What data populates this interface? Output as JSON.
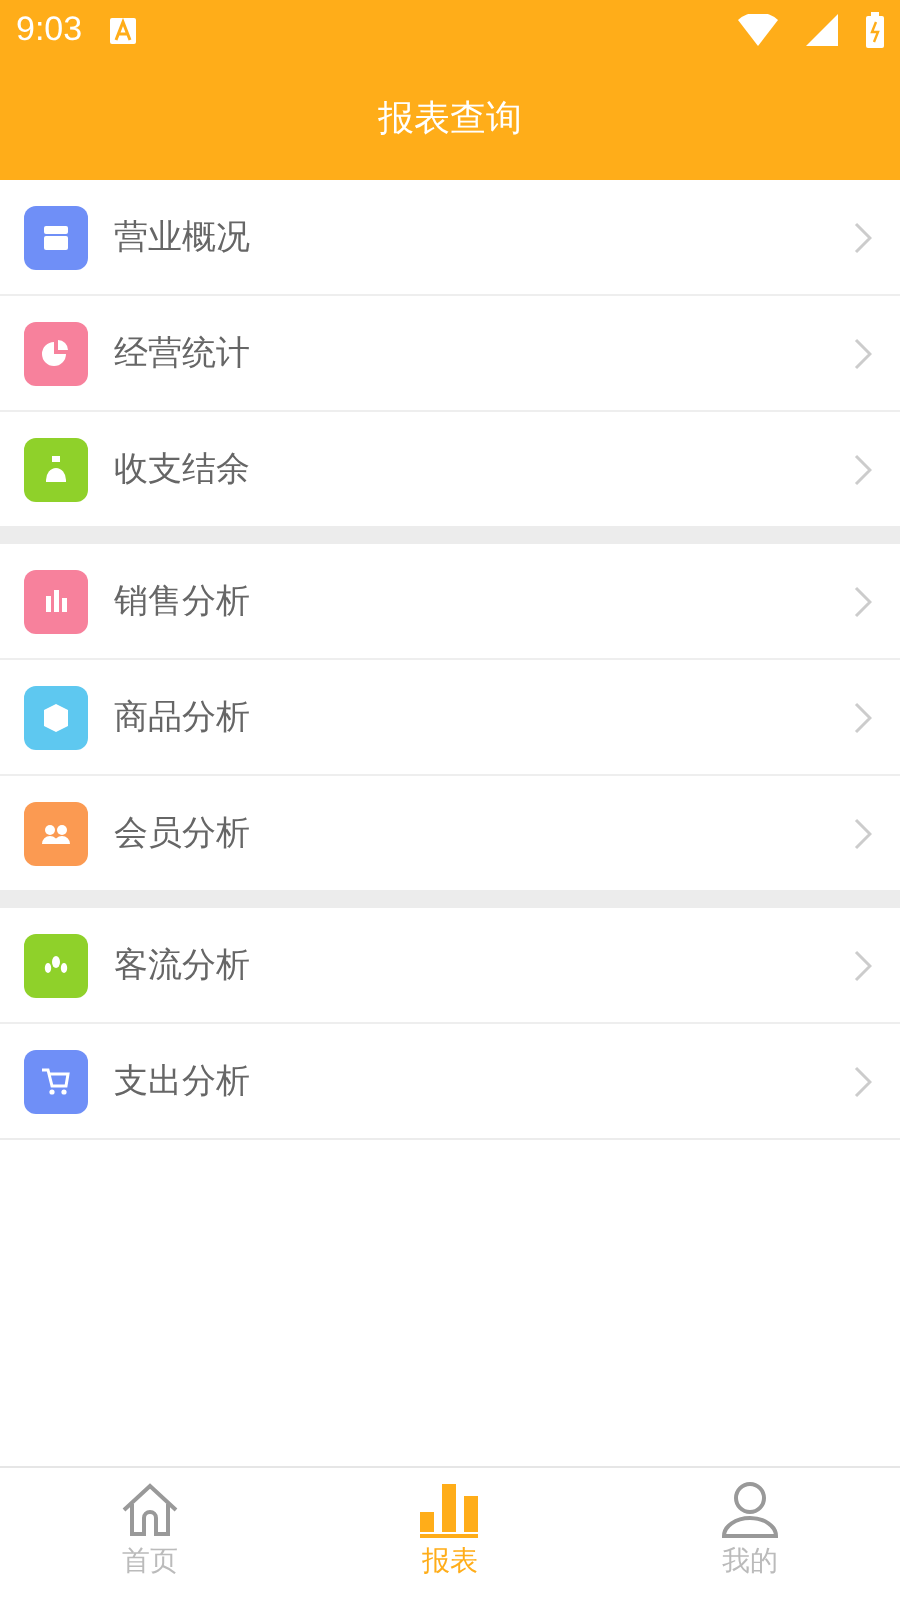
{
  "status_bar": {
    "time": "9:03"
  },
  "header": {
    "title": "报表查询"
  },
  "groups": [
    {
      "items": [
        {
          "label": "营业概况",
          "color": "#6f8ff7"
        },
        {
          "label": "经营统计",
          "color": "#f7819c"
        },
        {
          "label": "收支结余",
          "color": "#8fd12a"
        }
      ]
    },
    {
      "items": [
        {
          "label": "销售分析",
          "color": "#f7819c"
        },
        {
          "label": "商品分析",
          "color": "#5ec8f0"
        },
        {
          "label": "会员分析",
          "color": "#fb9a52"
        }
      ]
    },
    {
      "items": [
        {
          "label": "客流分析",
          "color": "#8fd12a"
        },
        {
          "label": "支出分析",
          "color": "#6f8ff7"
        }
      ]
    }
  ],
  "tabs": [
    {
      "label": "首页",
      "selected": false
    },
    {
      "label": "报表",
      "selected": true
    },
    {
      "label": "我的",
      "selected": false
    }
  ]
}
